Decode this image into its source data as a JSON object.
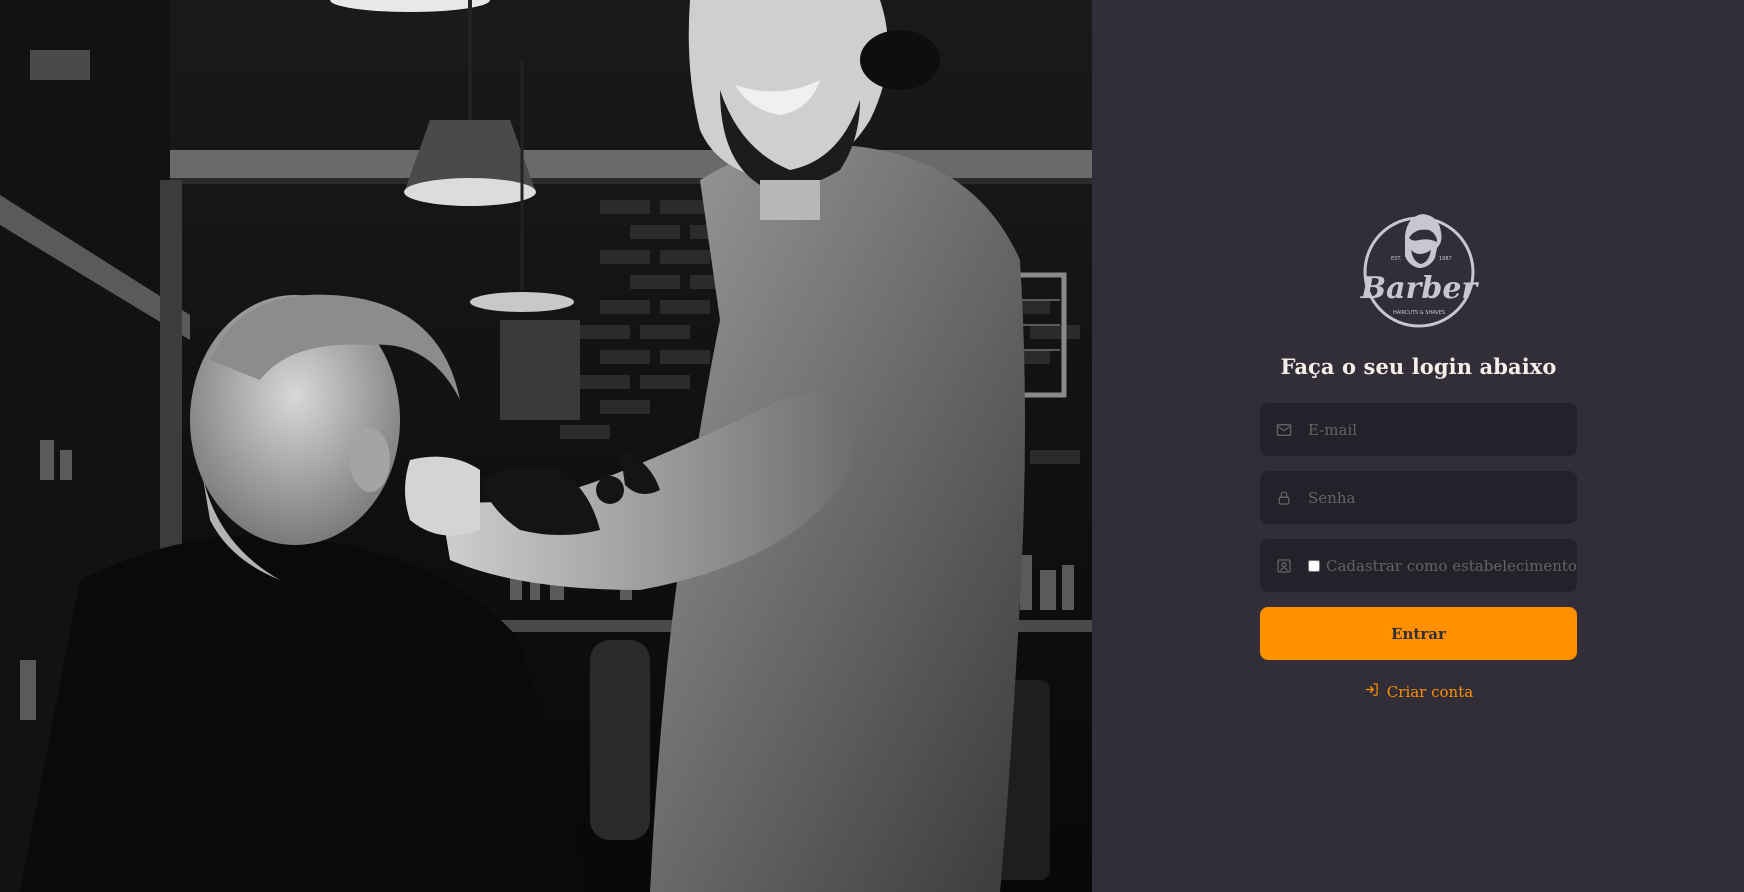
{
  "login": {
    "title": "Faça o seu login abaixo",
    "email_placeholder": "E-mail",
    "password_placeholder": "Senha",
    "establishment_label": "Cadastrar como estabelecimento",
    "submit_label": "Entrar",
    "create_account_label": "Criar conta"
  },
  "logo": {
    "brand": "Barber",
    "tagline": "HAIRCUTS & SHAVES",
    "est_left": "EST.",
    "est_right": "1987"
  },
  "icons": {
    "email": "mail-icon",
    "password": "lock-icon",
    "establishment": "user-badge-icon",
    "create_account": "log-in-icon"
  },
  "colors": {
    "background": "#312e38",
    "input_background": "#232129",
    "accent": "#ff9000",
    "text": "#f4ede8",
    "placeholder": "#666360"
  }
}
